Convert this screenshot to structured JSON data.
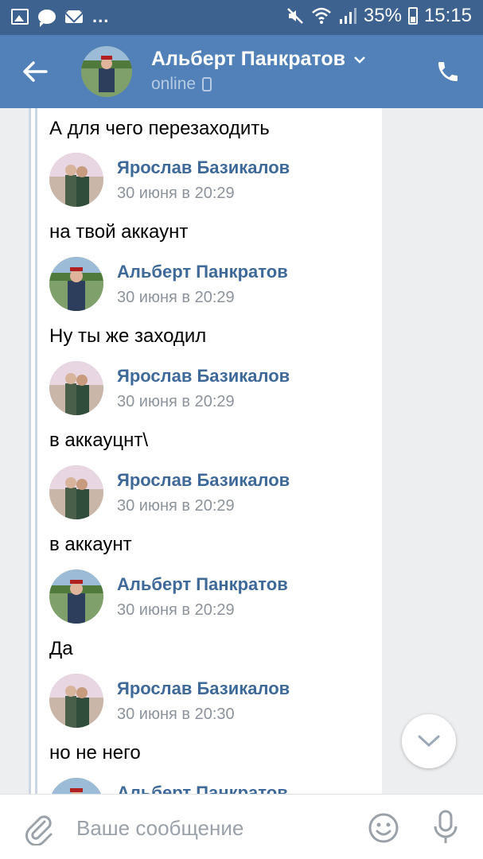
{
  "status_bar": {
    "dots": "...",
    "battery_percent": "35%",
    "time": "15:15"
  },
  "header": {
    "contact_name": "Альберт Панкратов",
    "status": "online"
  },
  "messages": [
    {
      "type": "text",
      "text": "А для чего перезаходить"
    },
    {
      "type": "sender",
      "name": "Ярослав Базикалов",
      "time": "30 июня в 20:29",
      "avatar": "yaroslav"
    },
    {
      "type": "text",
      "text": "на твой аккаунт"
    },
    {
      "type": "sender",
      "name": "Альберт Панкратов",
      "time": "30 июня в 20:29",
      "avatar": "albert"
    },
    {
      "type": "text",
      "text": "Ну ты же заходил"
    },
    {
      "type": "sender",
      "name": "Ярослав Базикалов",
      "time": "30 июня в 20:29",
      "avatar": "yaroslav"
    },
    {
      "type": "text",
      "text": "в аккауцнт\\"
    },
    {
      "type": "sender",
      "name": "Ярослав Базикалов",
      "time": "30 июня в 20:29",
      "avatar": "yaroslav"
    },
    {
      "type": "text",
      "text": "в аккаунт"
    },
    {
      "type": "sender",
      "name": "Альберт Панкратов",
      "time": "30 июня в 20:29",
      "avatar": "albert"
    },
    {
      "type": "text",
      "text": "Да"
    },
    {
      "type": "sender",
      "name": "Ярослав Базикалов",
      "time": "30 июня в 20:30",
      "avatar": "yaroslav"
    },
    {
      "type": "text",
      "text": "но не него"
    },
    {
      "type": "sender",
      "name": "Альберт Панкратов",
      "time": "",
      "avatar": "albert"
    }
  ],
  "input": {
    "placeholder": "Ваше сообщение",
    "value": ""
  },
  "colors": {
    "status_bar": "#3e6290",
    "header": "#5181b8",
    "link_name": "#3f6998",
    "time": "#8c939c"
  },
  "icons": {
    "back": "arrow-left-icon",
    "call": "phone-icon",
    "dropdown": "chevron-down-icon",
    "scroll_down": "chevron-down-icon",
    "attach": "paperclip-icon",
    "emoji": "smiley-icon",
    "mic": "microphone-icon"
  }
}
